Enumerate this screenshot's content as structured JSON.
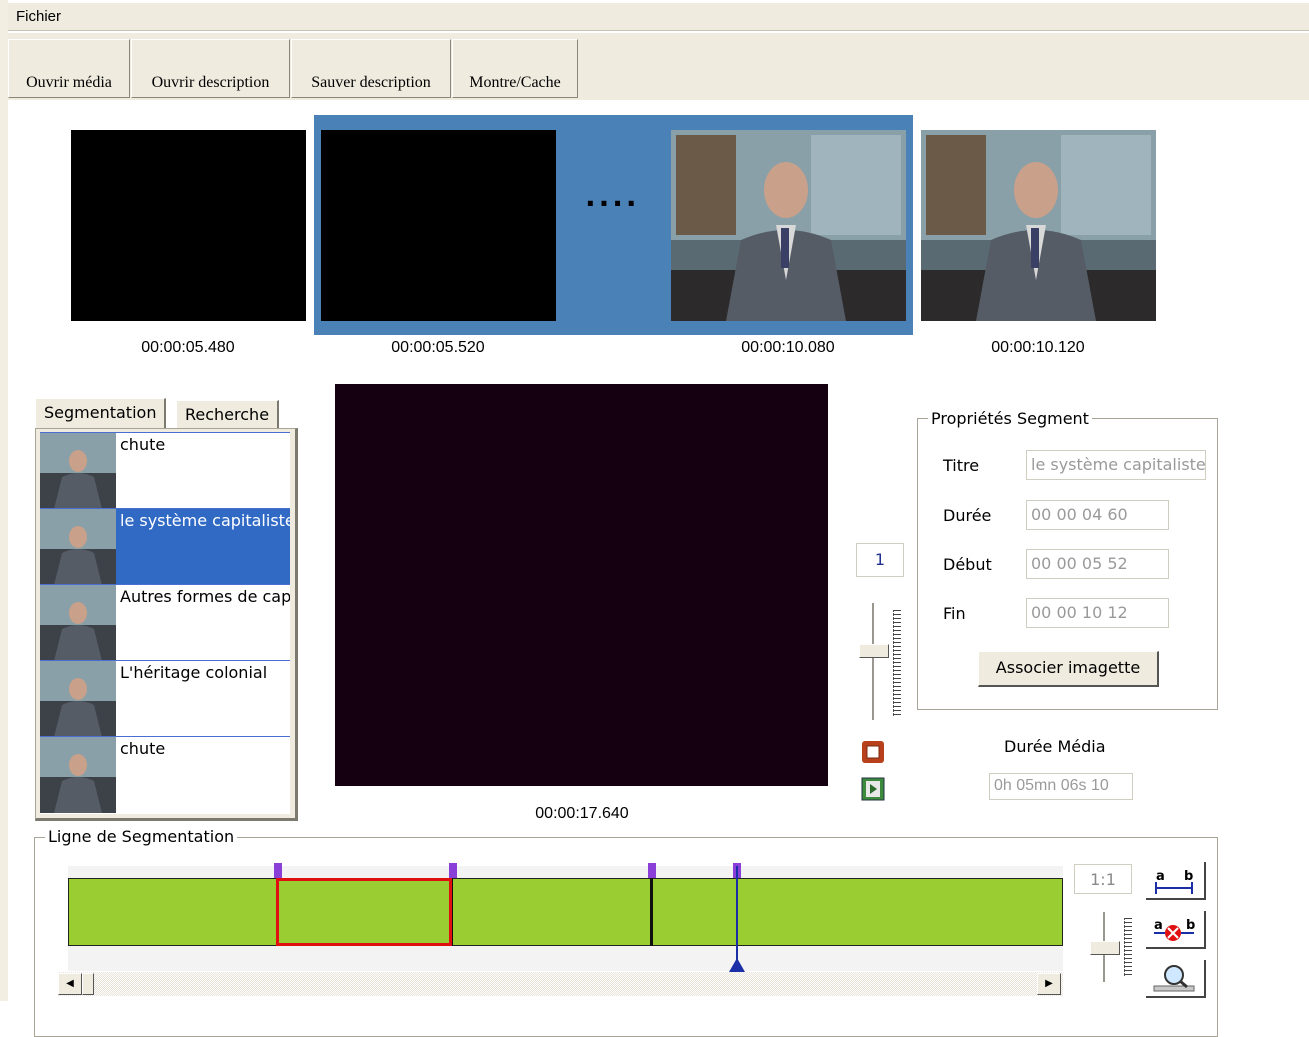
{
  "menu": {
    "file": "Fichier"
  },
  "toolbar": {
    "open_media": "Ouvrir média",
    "open_description": "Ouvrir description",
    "save_description": "Sauver description",
    "show_hide": "Montre/Cache"
  },
  "filmstrip": {
    "ellipsis": "....",
    "frames": [
      {
        "timecode": "00:00:05.480",
        "content": "black"
      },
      {
        "timecode": "00:00:05.520",
        "content": "black",
        "selected": true
      },
      {
        "timecode": "00:00:10.080",
        "content": "speaker",
        "selected": true
      },
      {
        "timecode": "00:00:10.120",
        "content": "speaker"
      }
    ]
  },
  "tabs": {
    "segmentation": "Segmentation",
    "search": "Recherche",
    "active": "segmentation"
  },
  "segments": [
    {
      "label": "chute"
    },
    {
      "label": "le système capitaliste",
      "selected": true
    },
    {
      "label": "Autres formes de capitalisme"
    },
    {
      "label": "L'héritage colonial"
    },
    {
      "label": "chute"
    }
  ],
  "player": {
    "timecode": "00:00:17.640",
    "speed": "1",
    "speed_slider_level": 0.4
  },
  "properties": {
    "legend": "Propriétés Segment",
    "title_label": "Titre",
    "title_value": "le système capitaliste",
    "duration_label": "Durée",
    "duration_value": "00 00 04 60",
    "start_label": "Début",
    "start_value": "00 00 05 52",
    "end_label": "Fin",
    "end_value": "00 00 10 12",
    "associate_button": "Associer imagette"
  },
  "media": {
    "duration_label": "Durée Média",
    "duration_value": "0h 05mn 06s 10"
  },
  "segline": {
    "legend": "Ligne de Segmentation",
    "zoom_ratio": "1:1",
    "icon_a": "a",
    "icon_b": "b",
    "colors": {
      "bar": "#9acd32",
      "selection": "#e01010",
      "marker": "#8a3fd8",
      "cursor": "#1a2ea8"
    }
  }
}
